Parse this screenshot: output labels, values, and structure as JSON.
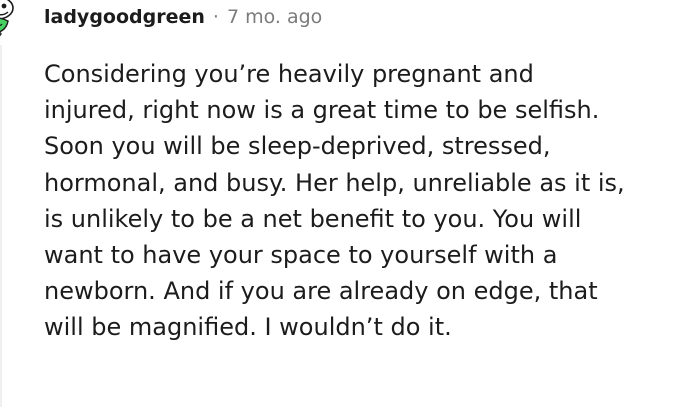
{
  "comment": {
    "author": "ladygoodgreen",
    "separator": "·",
    "time": "7 mo. ago",
    "lines": [
      "Considering you’re heavily pregnant and",
      "injured, right now is a great time to be selfish.",
      "Soon you will be sleep-deprived, stressed,",
      "hormonal, and busy. Her help, unreliable as it is,",
      "is unlikely to be a net benefit to you. You will",
      "want to have your space to yourself with a",
      "newborn. And if you are already on edge, that",
      "will be magnified. I wouldn’t do it."
    ]
  },
  "colors": {
    "text": "#1c1c1c",
    "meta": "#7c7c7c",
    "avatar_green": "#46d160",
    "thread_line": "#edeff1"
  },
  "icons": {
    "avatar": "snoo-avatar-icon"
  }
}
